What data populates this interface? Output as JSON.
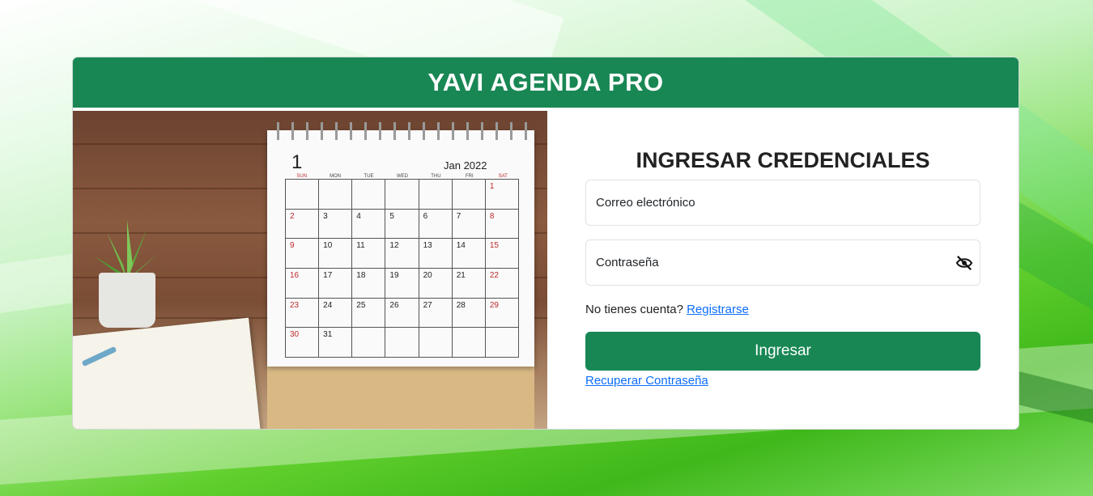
{
  "header": {
    "title": "YAVI AGENDA PRO"
  },
  "image": {
    "calendar_day": "1",
    "calendar_month": "Jan 2022",
    "weekdays": [
      "SUN",
      "MON",
      "TUE",
      "WED",
      "THU",
      "FRI",
      "SAT"
    ],
    "days": [
      "",
      "",
      "",
      "",
      "",
      "",
      "1",
      "2",
      "3",
      "4",
      "5",
      "6",
      "7",
      "8",
      "9",
      "10",
      "11",
      "12",
      "13",
      "14",
      "15",
      "16",
      "17",
      "18",
      "19",
      "20",
      "21",
      "22",
      "23",
      "24",
      "25",
      "26",
      "27",
      "28",
      "29",
      "30",
      "31",
      "",
      "",
      "",
      "",
      ""
    ]
  },
  "form": {
    "title": "INGRESAR CREDENCIALES",
    "email_label": "Correo electrónico",
    "password_label": "Contraseña",
    "no_account_text": "No tienes cuenta?",
    "register_link": "Registrarse",
    "submit_label": "Ingresar",
    "recover_link": "Recuperar Contraseña"
  },
  "colors": {
    "primary": "#198754",
    "link": "#0d6efd"
  },
  "icons": {
    "password_toggle": "eye-slash-icon"
  }
}
